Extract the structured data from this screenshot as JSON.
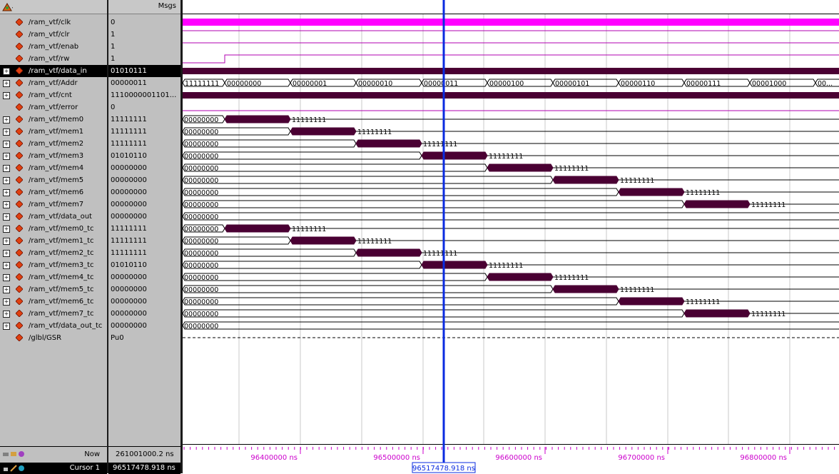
{
  "header": {
    "msgs_label": "Msgs"
  },
  "signals": [
    {
      "name": "/ram_vtf/clk",
      "value": "0",
      "expandable": false
    },
    {
      "name": "/ram_vtf/clr",
      "value": "1",
      "expandable": false
    },
    {
      "name": "/ram_vtf/enab",
      "value": "1",
      "expandable": false
    },
    {
      "name": "/ram_vtf/rw",
      "value": "1",
      "expandable": false
    },
    {
      "name": "/ram_vtf/data_in",
      "value": "01010111",
      "expandable": true,
      "selected": true
    },
    {
      "name": "/ram_vtf/Addr",
      "value": "00000011",
      "expandable": true
    },
    {
      "name": "/ram_vtf/cnt",
      "value": "1110000001101...",
      "expandable": true
    },
    {
      "name": "/ram_vtf/error",
      "value": "0",
      "expandable": false
    },
    {
      "name": "/ram_vtf/mem0",
      "value": "11111111",
      "expandable": true
    },
    {
      "name": "/ram_vtf/mem1",
      "value": "11111111",
      "expandable": true
    },
    {
      "name": "/ram_vtf/mem2",
      "value": "11111111",
      "expandable": true
    },
    {
      "name": "/ram_vtf/mem3",
      "value": "01010110",
      "expandable": true
    },
    {
      "name": "/ram_vtf/mem4",
      "value": "00000000",
      "expandable": true
    },
    {
      "name": "/ram_vtf/mem5",
      "value": "00000000",
      "expandable": true
    },
    {
      "name": "/ram_vtf/mem6",
      "value": "00000000",
      "expandable": true
    },
    {
      "name": "/ram_vtf/mem7",
      "value": "00000000",
      "expandable": true
    },
    {
      "name": "/ram_vtf/data_out",
      "value": "00000000",
      "expandable": true
    },
    {
      "name": "/ram_vtf/mem0_tc",
      "value": "11111111",
      "expandable": true
    },
    {
      "name": "/ram_vtf/mem1_tc",
      "value": "11111111",
      "expandable": true
    },
    {
      "name": "/ram_vtf/mem2_tc",
      "value": "11111111",
      "expandable": true
    },
    {
      "name": "/ram_vtf/mem3_tc",
      "value": "01010110",
      "expandable": true
    },
    {
      "name": "/ram_vtf/mem4_tc",
      "value": "00000000",
      "expandable": true
    },
    {
      "name": "/ram_vtf/mem5_tc",
      "value": "00000000",
      "expandable": true
    },
    {
      "name": "/ram_vtf/mem6_tc",
      "value": "00000000",
      "expandable": true
    },
    {
      "name": "/ram_vtf/mem7_tc",
      "value": "00000000",
      "expandable": true
    },
    {
      "name": "/ram_vtf/data_out_tc",
      "value": "00000000",
      "expandable": true
    },
    {
      "name": "/glbl/GSR",
      "value": "Pu0",
      "expandable": false
    }
  ],
  "wave_labels": {
    "addr": [
      "11111111",
      "00000000",
      "00000001",
      "00000010",
      "00000011",
      "00000100",
      "00000101",
      "00000110",
      "00000111",
      "00001000",
      "00..."
    ],
    "zero": "00000000",
    "ones": "11111111"
  },
  "timeline": {
    "ticks": [
      "96400000 ns",
      "96500000 ns",
      "96600000 ns",
      "96700000 ns",
      "96800000 ns"
    ],
    "cursor_time": "96517478.918 ns"
  },
  "status": {
    "now_label": "Now",
    "now_value": "261001000.2 ns",
    "cursor_label": "Cursor 1",
    "cursor_value": "96517478.918 ns"
  },
  "colors": {
    "clock": "#ff00ff",
    "bus": "#4a0033",
    "cursor": "#0a2be0",
    "timeline_text": "#cc00cc"
  }
}
